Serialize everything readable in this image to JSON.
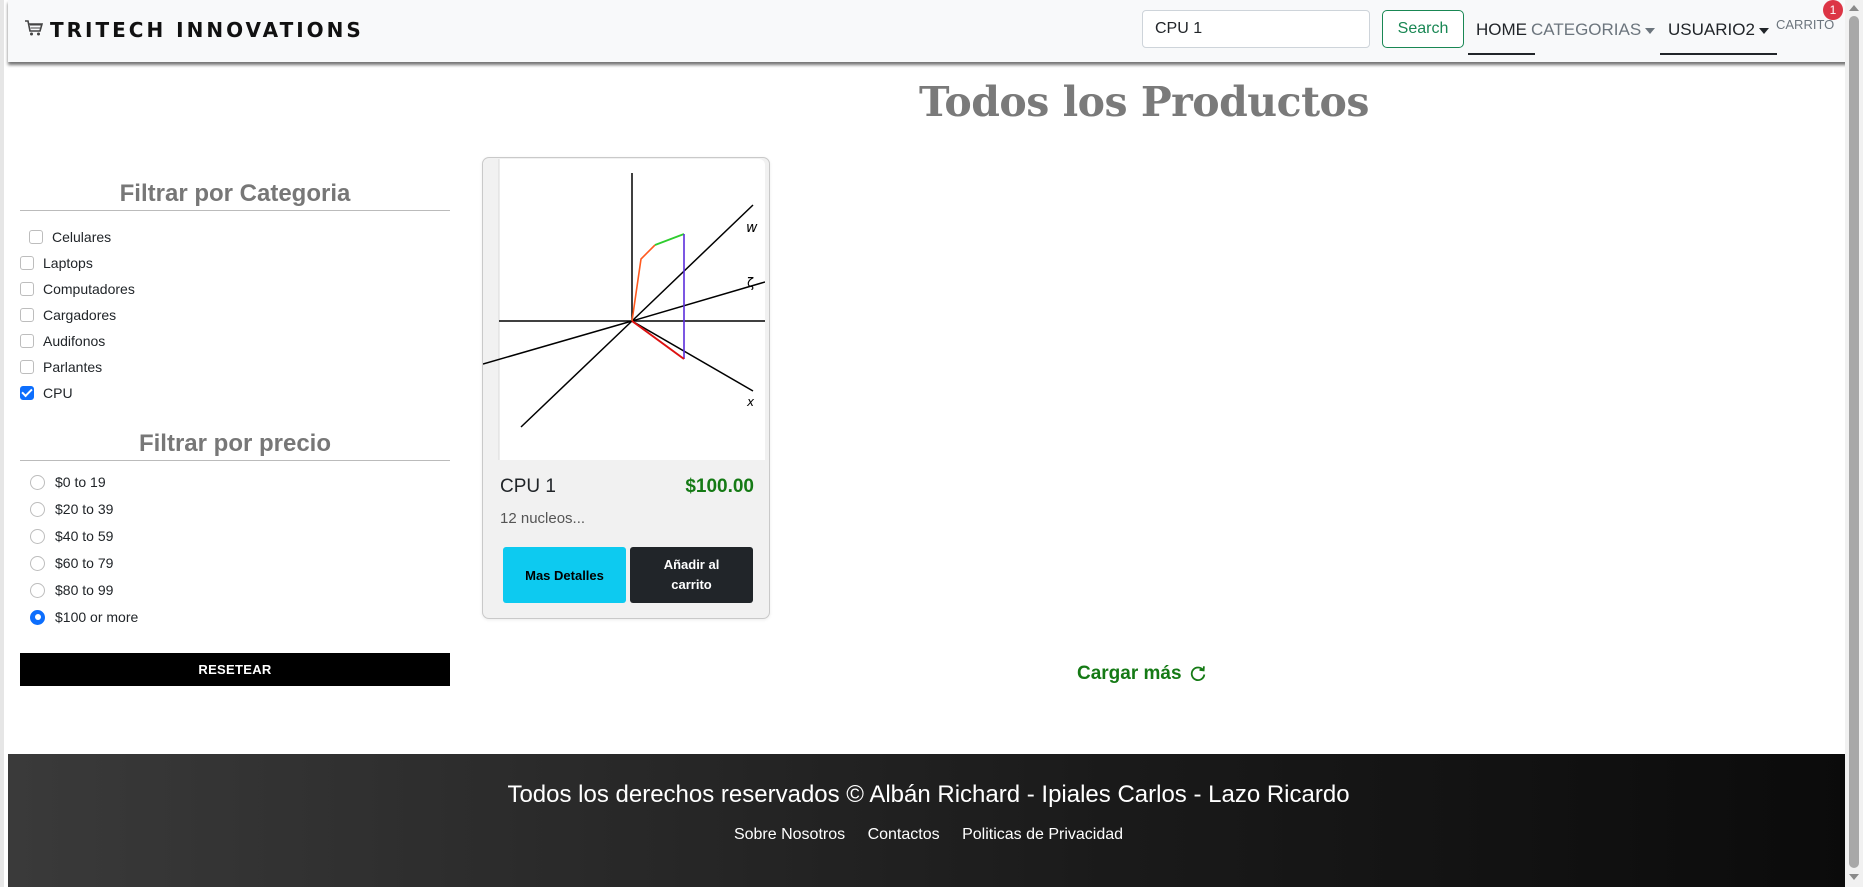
{
  "navbar": {
    "brand": "TRITECH INNOVATIONS",
    "brand_icon": "cart-icon",
    "search_value": "CPU 1",
    "search_button": "Search",
    "home": "HOME",
    "categorias": "CATEGORIAS",
    "usuario": "USUARIO2",
    "carrito": "CARRITO",
    "cart_count": "1"
  },
  "main": {
    "title": "Todos los Productos"
  },
  "filters": {
    "category_heading": "Filtrar por Categoria",
    "categories": [
      {
        "label": "Celulares",
        "checked": false
      },
      {
        "label": "Laptops",
        "checked": false
      },
      {
        "label": "Computadores",
        "checked": false
      },
      {
        "label": "Cargadores",
        "checked": false
      },
      {
        "label": "Audifonos",
        "checked": false
      },
      {
        "label": "Parlantes",
        "checked": false
      },
      {
        "label": "CPU",
        "checked": true
      }
    ],
    "price_heading": "Filtrar por precio",
    "prices": [
      {
        "label": "$0 to 19",
        "checked": false
      },
      {
        "label": "$20 to 39",
        "checked": false
      },
      {
        "label": "$40 to 59",
        "checked": false
      },
      {
        "label": "$60 to 79",
        "checked": false
      },
      {
        "label": "$80 to 99",
        "checked": false
      },
      {
        "label": "$100 or more",
        "checked": true
      }
    ],
    "reset": "RESETEAR"
  },
  "product": {
    "name": "CPU 1",
    "price": "$100.00",
    "description": "12 nucleos...",
    "details_button": "Mas Detalles",
    "cart_button": "Añadir al carrito",
    "axis_labels": [
      "w",
      "ζ",
      "x"
    ]
  },
  "load_more": "Cargar más",
  "footer": {
    "title": "Todos los derechos reservados © Albán Richard - Ipiales Carlos - Lazo Ricardo",
    "links": [
      "Sobre Nosotros",
      "Contactos",
      "Politicas de Privacidad"
    ]
  },
  "colors": {
    "accent_green": "#157a15",
    "info_cyan": "#0dcaf0",
    "badge_red": "#dc3545",
    "checkbox_blue": "#0d6efd"
  }
}
